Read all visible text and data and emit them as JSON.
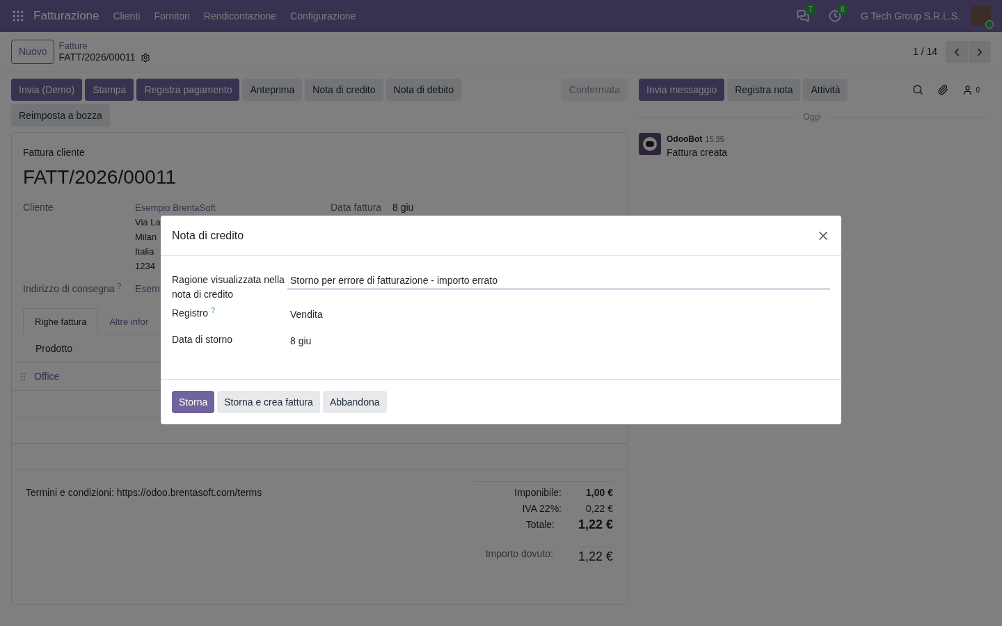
{
  "navbar": {
    "app_name": "Fatturazione",
    "menu": [
      "Clienti",
      "Fornitori",
      "Rendicontazione",
      "Configurazione"
    ],
    "chat_count": "7",
    "activity_count": "8",
    "company": "G Tech Group S.R.L.S."
  },
  "control_panel": {
    "new_button": "Nuovo",
    "breadcrumb_parent": "Fatture",
    "record": "FATT/2026/00011",
    "pager": "1 / 14"
  },
  "actions": {
    "buttons": [
      {
        "label": "Invia (Demo)",
        "kind": "primary"
      },
      {
        "label": "Stampa",
        "kind": "primary"
      },
      {
        "label": "Registra pagamento",
        "kind": "primary"
      },
      {
        "label": "Anteprima",
        "kind": "secondary"
      },
      {
        "label": "Nota di credito",
        "kind": "secondary"
      },
      {
        "label": "Nota di debito",
        "kind": "secondary"
      },
      {
        "label": "Reimposta a bozza",
        "kind": "secondary"
      }
    ],
    "status": "Confermata"
  },
  "invoice": {
    "type_label": "Fattura cliente",
    "number": "FATT/2026/00011",
    "customer_label": "Cliente",
    "customer_lines": [
      {
        "text": "Esempio BrentaSoft",
        "kind": "link"
      },
      {
        "text": "Via La",
        "kind": "text"
      },
      {
        "text": "Milan",
        "kind": "text"
      },
      {
        "text": "Italia",
        "kind": "text"
      },
      {
        "text": "1234",
        "kind": "text"
      }
    ],
    "date_label": "Data fattura",
    "date_value": "8 giu",
    "delivery_label": "Indirizzo di consegna",
    "delivery_help": "?",
    "delivery_value": "Esem",
    "tabs": [
      {
        "label": "Righe fattura",
        "selected": true
      },
      {
        "label": "Altre infor",
        "selected": false
      }
    ],
    "columns": [
      "Prodotto"
    ],
    "lines": [
      {
        "product": "Office"
      }
    ],
    "terms": "Termini e condizioni: https://odoo.brentasoft.com/terms",
    "totals": [
      {
        "label": "Imponibile:",
        "value": "1,00 €",
        "kind": "bold"
      },
      {
        "label": "IVA 22%:",
        "value": "0,22 €",
        "kind": "plain"
      },
      {
        "label": "Totale:",
        "value": "1,22 €",
        "kind": "total"
      }
    ],
    "due_label": "Importo dovuto:",
    "due_value": "1,22 €"
  },
  "chatter": {
    "buttons": [
      {
        "label": "Invia messaggio",
        "kind": "primary"
      },
      {
        "label": "Registra nota",
        "kind": "secondary"
      },
      {
        "label": "Attività",
        "kind": "secondary"
      }
    ],
    "followers_count": "0",
    "date_separator": "Oggi",
    "messages": [
      {
        "author": "OdooBot",
        "time": "15:35",
        "body": "Fattura creata"
      }
    ]
  },
  "dialog": {
    "title": "Nota di credito",
    "fields": [
      {
        "label": "Ragione visualizzata nella nota di credito",
        "value": "Storno per errore di fatturazione - importo errato",
        "kind": "input"
      },
      {
        "label": "Registro",
        "value": "Vendita",
        "kind": "text",
        "help": "?"
      },
      {
        "label": "Data di storno",
        "value": "8 giu",
        "kind": "text"
      }
    ],
    "buttons": [
      {
        "label": "Storna",
        "kind": "primary"
      },
      {
        "label": "Storna e crea fattura",
        "kind": "secondary"
      },
      {
        "label": "Abbandona",
        "kind": "secondary"
      }
    ]
  }
}
